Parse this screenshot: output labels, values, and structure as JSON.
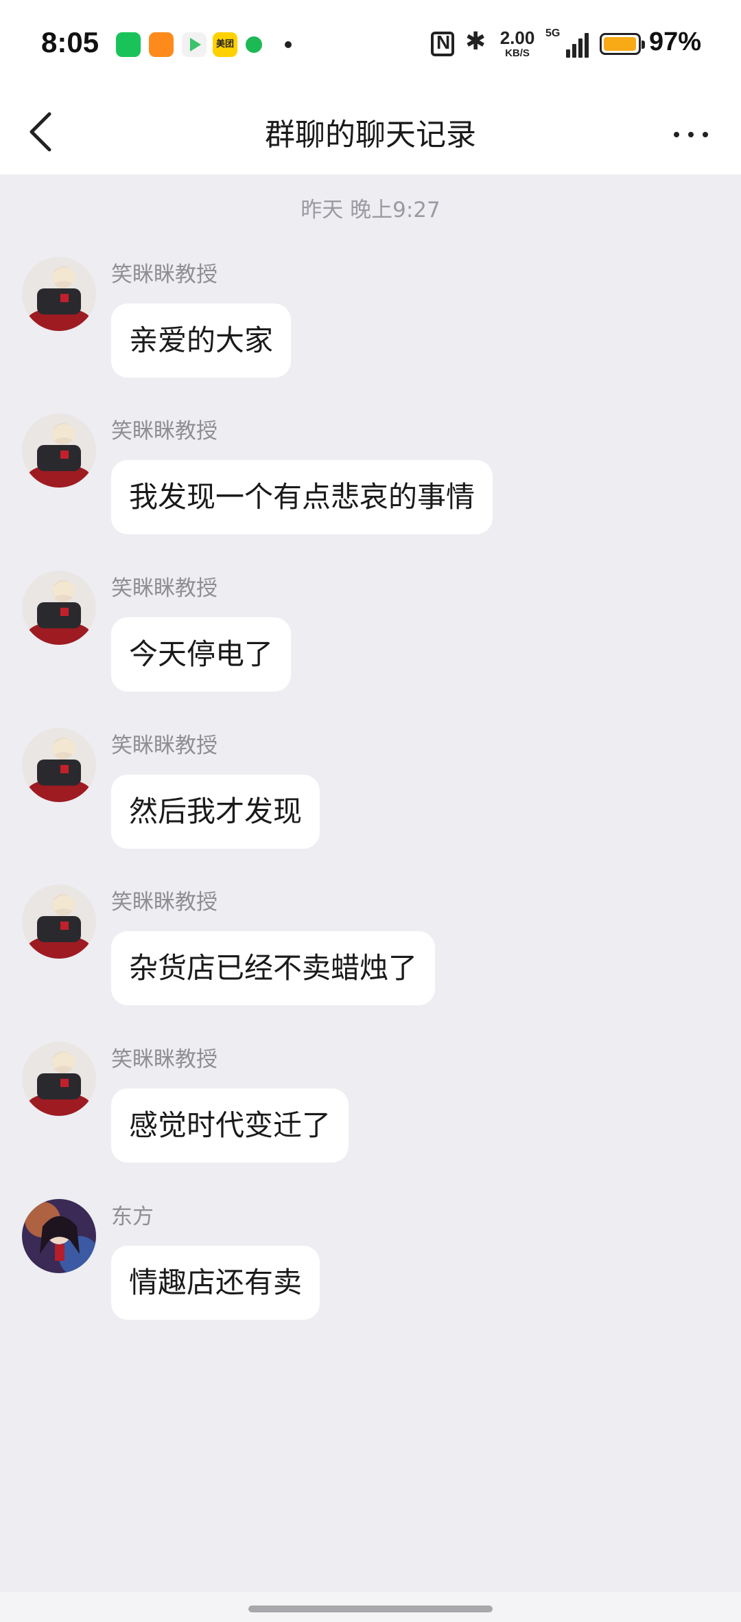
{
  "status_bar": {
    "time": "8:05",
    "apps": [
      "wechat-icon",
      "orange-app-icon",
      "video-app-icon",
      "meituan-icon",
      "green-dot-app-icon"
    ],
    "meituan_label": "美团",
    "net_speed_value": "2.00",
    "net_speed_unit": "KB/S",
    "network_type": "5G",
    "battery_percent": "97%",
    "battery_level": 0.97,
    "battery_color": "#F7A916"
  },
  "nav": {
    "back_icon": "chevron-left-icon",
    "title": "群聊的聊天记录",
    "more_icon": "more-horizontal-icon"
  },
  "chat": {
    "time_divider": "昨天 晚上9:27",
    "messages": [
      {
        "sender": "笑眯眯教授",
        "text": "亲爱的大家"
      },
      {
        "sender": "笑眯眯教授",
        "text": "我发现一个有点悲哀的事情"
      },
      {
        "sender": "笑眯眯教授",
        "text": "今天停电了"
      },
      {
        "sender": "笑眯眯教授",
        "text": "然后我才发现"
      },
      {
        "sender": "笑眯眯教授",
        "text": "杂货店已经不卖蜡烛了"
      },
      {
        "sender": "笑眯眯教授",
        "text": "感觉时代变迁了"
      },
      {
        "sender": "东方",
        "text": "情趣店还有卖"
      }
    ]
  },
  "colors": {
    "background": "#EDEDF2",
    "bubble": "#FFFFFF",
    "sender_text": "#8E8E93"
  }
}
